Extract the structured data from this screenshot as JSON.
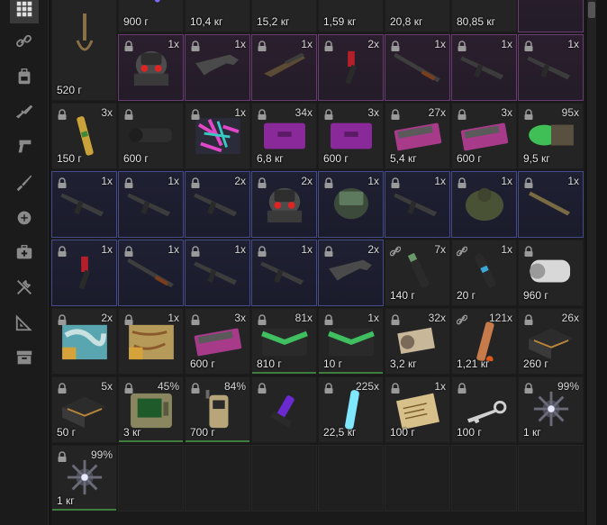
{
  "sidebar": {
    "items": [
      {
        "name": "all-grid-icon",
        "active": true
      },
      {
        "name": "chain-link-icon"
      },
      {
        "name": "backpack-icon"
      },
      {
        "name": "rifle-icon"
      },
      {
        "name": "pistol-icon"
      },
      {
        "name": "knife-icon"
      },
      {
        "name": "grenade-icon"
      },
      {
        "name": "medkit-icon"
      },
      {
        "name": "tools-icon"
      },
      {
        "name": "ruler-triangle-icon"
      },
      {
        "name": "archive-box-icon"
      }
    ]
  },
  "grid": {
    "rows": [
      [
        {
          "weight": "520 г",
          "count": "",
          "rarity": "",
          "icon": "rope-noose"
        },
        {
          "weight": "900 г",
          "count": "",
          "rarity": "",
          "icon": "glow-stick-purple"
        },
        {
          "weight": "10,4 кг",
          "count": "",
          "rarity": "",
          "icon": "red-case"
        },
        {
          "weight": "15,2 кг",
          "count": "",
          "rarity": "",
          "icon": "red-case-large"
        },
        {
          "weight": "1,59 кг",
          "count": "",
          "rarity": "",
          "icon": "box"
        },
        {
          "weight": "20,8 кг",
          "count": "",
          "rarity": "",
          "icon": "orange-gear"
        },
        {
          "weight": "80,85 кг",
          "count": "",
          "rarity": "",
          "icon": "crate"
        },
        {
          "weight": "",
          "count": "",
          "rarity": "rare",
          "icon": "weapon"
        }
      ],
      [
        {
          "weight": "",
          "count": "",
          "rarity": "",
          "icon": "rope-noose-continued"
        },
        {
          "weight": "",
          "count": "1x",
          "rarity": "rare",
          "icon": "power-armor-red-eyes"
        },
        {
          "weight": "",
          "count": "1x",
          "rarity": "rare",
          "icon": "rifle"
        },
        {
          "weight": "",
          "count": "1x",
          "rarity": "rare",
          "icon": "shotgun"
        },
        {
          "weight": "",
          "count": "2x",
          "rarity": "rare",
          "icon": "red-pistol"
        },
        {
          "weight": "",
          "count": "1x",
          "rarity": "rare",
          "icon": "pump-shotgun"
        },
        {
          "weight": "",
          "count": "1x",
          "rarity": "rare",
          "icon": "assault-rifle"
        },
        {
          "weight": "",
          "count": "1x",
          "rarity": "rare",
          "icon": "assault-rifle"
        }
      ],
      [
        {
          "weight": "150 г",
          "count": "3x",
          "rarity": "",
          "icon": "gold-rod"
        },
        {
          "weight": "600 г",
          "count": "",
          "rarity": "",
          "icon": "scope"
        },
        {
          "weight": "",
          "count": "1x",
          "rarity": "",
          "icon": "neon-camo-patch"
        },
        {
          "weight": "6,8 кг",
          "count": "34x",
          "rarity": "",
          "icon": "purple-case"
        },
        {
          "weight": "600 г",
          "count": "3x",
          "rarity": "",
          "icon": "purple-case"
        },
        {
          "weight": "5,4 кг",
          "count": "27x",
          "rarity": "",
          "icon": "pink-weapon-case"
        },
        {
          "weight": "600 г",
          "count": "3x",
          "rarity": "",
          "icon": "pink-weapon-case"
        },
        {
          "weight": "9,5 кг",
          "count": "95x",
          "rarity": "",
          "icon": "green-canister"
        }
      ],
      [
        {
          "weight": "",
          "count": "1x",
          "rarity": "epic",
          "icon": "assault-rifle"
        },
        {
          "weight": "",
          "count": "1x",
          "rarity": "epic",
          "icon": "assault-rifle"
        },
        {
          "weight": "",
          "count": "2x",
          "rarity": "epic",
          "icon": "assault-rifle"
        },
        {
          "weight": "",
          "count": "2x",
          "rarity": "epic",
          "icon": "power-armor-red-eyes"
        },
        {
          "weight": "",
          "count": "1x",
          "rarity": "epic",
          "icon": "armor-green-visor"
        },
        {
          "weight": "",
          "count": "1x",
          "rarity": "epic",
          "icon": "assault-rifle"
        },
        {
          "weight": "",
          "count": "1x",
          "rarity": "epic",
          "icon": "heavy-armor"
        },
        {
          "weight": "",
          "count": "1x",
          "rarity": "epic",
          "icon": "smg"
        }
      ],
      [
        {
          "weight": "",
          "count": "1x",
          "rarity": "epic",
          "icon": "red-pistol"
        },
        {
          "weight": "",
          "count": "1x",
          "rarity": "epic",
          "icon": "pump-shotgun"
        },
        {
          "weight": "",
          "count": "1x",
          "rarity": "epic",
          "icon": "assault-rifle"
        },
        {
          "weight": "",
          "count": "1x",
          "rarity": "epic",
          "icon": "assault-rifle"
        },
        {
          "weight": "",
          "count": "2x",
          "rarity": "epic",
          "icon": "rifle"
        },
        {
          "weight": "140 г",
          "count": "7x",
          "rarity": "",
          "icon": "silencer",
          "linked": true
        },
        {
          "weight": "20 г",
          "count": "1x",
          "rarity": "",
          "icon": "silencer-blue",
          "linked": true
        },
        {
          "weight": "960 г",
          "count": "",
          "rarity": "",
          "icon": "thermal-scope"
        }
      ],
      [
        {
          "weight": "",
          "count": "2x",
          "rarity": "",
          "icon": "map-blue"
        },
        {
          "weight": "",
          "count": "1x",
          "rarity": "",
          "icon": "map-orange"
        },
        {
          "weight": "600 г",
          "count": "3x",
          "rarity": "",
          "icon": "pink-weapon-case"
        },
        {
          "weight": "810 г",
          "count": "81x",
          "rarity": "",
          "icon": "green-box",
          "green": true
        },
        {
          "weight": "10 г",
          "count": "1x",
          "rarity": "",
          "icon": "green-box",
          "green": true
        },
        {
          "weight": "3,2 кг",
          "count": "32x",
          "rarity": "",
          "icon": "tube-bracket"
        },
        {
          "weight": "1,21 кг",
          "count": "121x",
          "rarity": "",
          "icon": "grenade-tube",
          "linked": true
        },
        {
          "weight": "260 г",
          "count": "26x",
          "rarity": "",
          "icon": "dark-case"
        }
      ],
      [
        {
          "weight": "50 г",
          "count": "5x",
          "rarity": "",
          "icon": "dark-case"
        },
        {
          "weight": "3 кг",
          "count": "45%",
          "rarity": "",
          "icon": "pip-terminal",
          "green": true
        },
        {
          "weight": "700 г",
          "count": "84%",
          "rarity": "",
          "icon": "detector",
          "green": true
        },
        {
          "weight": "",
          "count": "",
          "rarity": "",
          "icon": "purple-vial"
        },
        {
          "weight": "22,5 кг",
          "count": "225x",
          "rarity": "",
          "icon": "blue-glow-stick"
        },
        {
          "weight": "100 г",
          "count": "1x",
          "rarity": "",
          "icon": "paper-notes"
        },
        {
          "weight": "100 г",
          "count": "",
          "rarity": "",
          "icon": "keys"
        },
        {
          "weight": "1 кг",
          "count": "99%",
          "rarity": "",
          "icon": "artifact-spiky"
        }
      ],
      [
        {
          "weight": "1 кг",
          "count": "99%",
          "rarity": "",
          "icon": "artifact-spiky",
          "green": true
        },
        {
          "empty": true
        },
        {
          "empty": true
        },
        {
          "empty": true
        },
        {
          "empty": true
        },
        {
          "empty": true
        },
        {
          "empty": true
        },
        {
          "empty": true
        }
      ]
    ]
  },
  "colors": {
    "rare_border": "#6a3b72",
    "epic_border": "#454a8c",
    "ok_green": "#3e7d3e"
  }
}
